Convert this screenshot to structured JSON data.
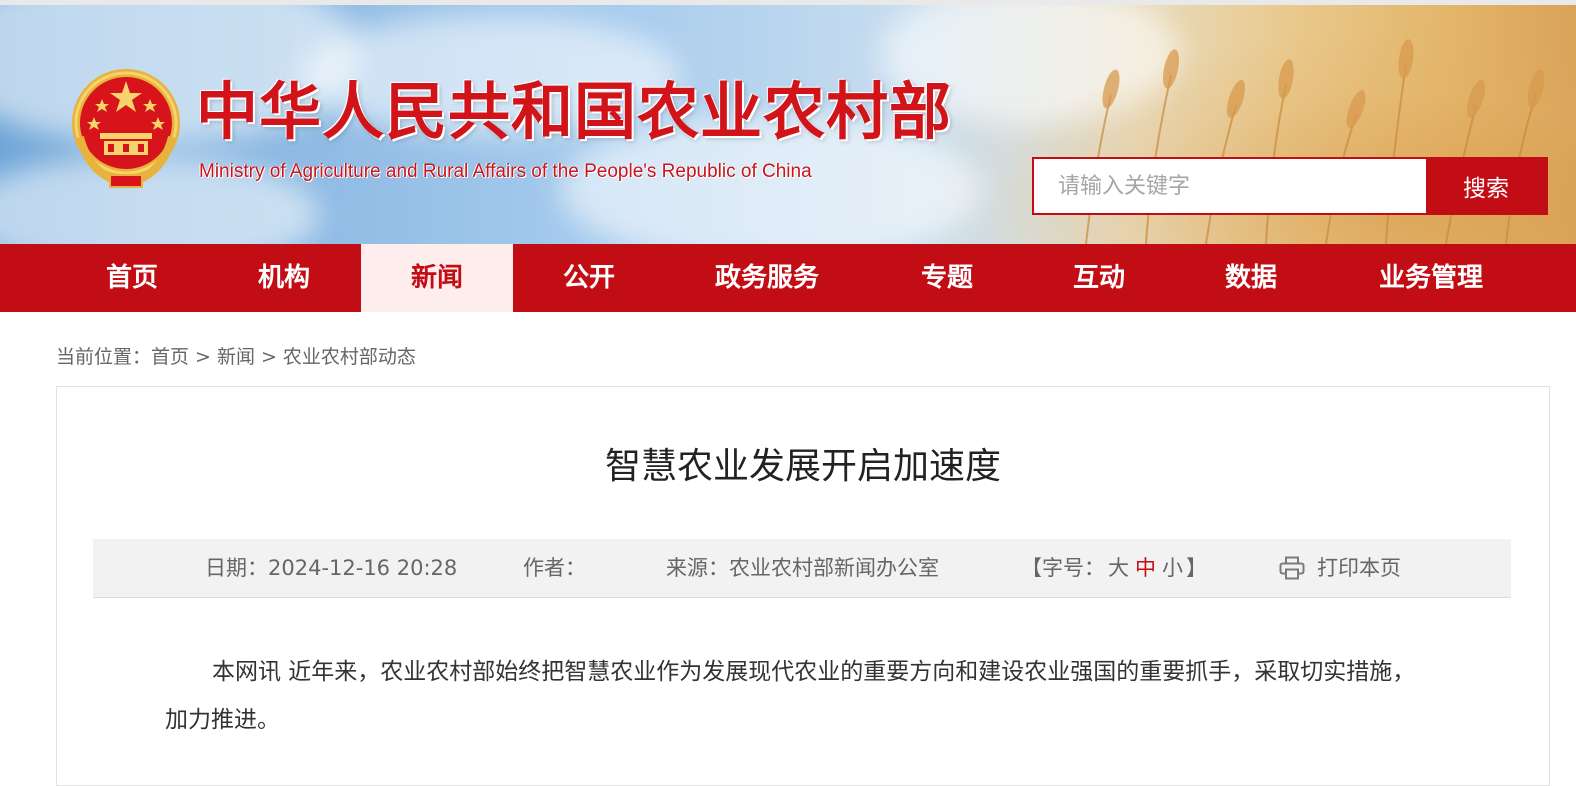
{
  "header": {
    "site_title": "中华人民共和国农业农村部",
    "site_subtitle": "Ministry of Agriculture and Rural Affairs of the People's Republic of China",
    "search": {
      "placeholder": "请输入关键字",
      "button_label": "搜索"
    }
  },
  "nav": {
    "items": [
      {
        "label": "首页"
      },
      {
        "label": "机构"
      },
      {
        "label": "新闻",
        "active": true
      },
      {
        "label": "公开"
      },
      {
        "label": "政务服务"
      },
      {
        "label": "专题"
      },
      {
        "label": "互动"
      },
      {
        "label": "数据"
      },
      {
        "label": "业务管理"
      }
    ]
  },
  "breadcrumb": {
    "prefix": "当前位置：",
    "items": [
      "首页",
      "新闻",
      "农业农村部动态"
    ],
    "separator": ">"
  },
  "article": {
    "title": "智慧农业发展开启加速度",
    "meta": {
      "date_label": "日期：",
      "date": "2024-12-16 20:28",
      "author_label": "作者：",
      "author": "",
      "source_label": "来源：",
      "source": "农业农村部新闻办公室",
      "font_size_open": "【字号：",
      "font_sizes": [
        "大",
        "中",
        "小"
      ],
      "font_size_current": "中",
      "font_size_close": "】",
      "print_label": "打印本页"
    },
    "body": "本网讯  近年来，农业农村部始终把智慧农业作为发展现代农业的重要方向和建设农业强国的重要抓手，采取切实措施，加力推进。"
  },
  "colors": {
    "brand_red": "#c30d15",
    "active_nav_bg": "#fdeded",
    "meta_bg": "#f2f2f2"
  },
  "icons": [
    "national-emblem-icon",
    "printer-icon"
  ]
}
